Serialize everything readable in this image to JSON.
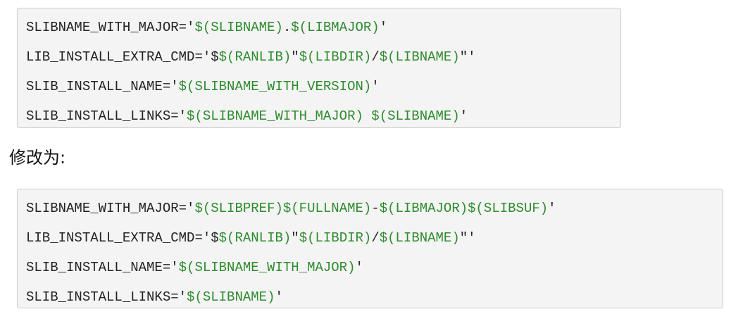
{
  "before_block": {
    "lines": [
      [
        {
          "t": "SLIBNAME_WITH_MAJOR='",
          "c": "plain"
        },
        {
          "t": "$(SLIBNAME)",
          "c": "str"
        },
        {
          "t": ".",
          "c": "plain"
        },
        {
          "t": "$(LIBMAJOR)",
          "c": "str"
        },
        {
          "t": "'",
          "c": "plain"
        }
      ],
      [
        {
          "t": "LIB_INSTALL_EXTRA_CMD='$",
          "c": "plain"
        },
        {
          "t": "$(RANLIB)",
          "c": "str"
        },
        {
          "t": "\"",
          "c": "plain"
        },
        {
          "t": "$(LIBDIR)",
          "c": "str"
        },
        {
          "t": "/",
          "c": "plain"
        },
        {
          "t": "$(LIBNAME)",
          "c": "str"
        },
        {
          "t": "\"'",
          "c": "plain"
        }
      ],
      [
        {
          "t": "SLIB_INSTALL_NAME='",
          "c": "plain"
        },
        {
          "t": "$(SLIBNAME_WITH_VERSION)",
          "c": "str"
        },
        {
          "t": "'",
          "c": "plain"
        }
      ],
      [
        {
          "t": "SLIB_INSTALL_LINKS='",
          "c": "plain"
        },
        {
          "t": "$(SLIBNAME_WITH_MAJOR)",
          "c": "str"
        },
        {
          "t": " ",
          "c": "plain"
        },
        {
          "t": "$(SLIBNAME)",
          "c": "str"
        },
        {
          "t": "'",
          "c": "plain"
        }
      ]
    ]
  },
  "heading": "修改为:",
  "after_block": {
    "lines": [
      [
        {
          "t": "SLIBNAME_WITH_MAJOR='",
          "c": "plain"
        },
        {
          "t": "$(SLIBPREF)",
          "c": "str"
        },
        {
          "t": "$(FULLNAME)",
          "c": "str"
        },
        {
          "t": "-",
          "c": "plain"
        },
        {
          "t": "$(LIBMAJOR)",
          "c": "str"
        },
        {
          "t": "$(SLIBSUF)",
          "c": "str"
        },
        {
          "t": "'",
          "c": "plain"
        }
      ],
      [
        {
          "t": "LIB_INSTALL_EXTRA_CMD='$",
          "c": "plain"
        },
        {
          "t": "$(RANLIB)",
          "c": "str"
        },
        {
          "t": "\"",
          "c": "plain"
        },
        {
          "t": "$(LIBDIR)",
          "c": "str"
        },
        {
          "t": "/",
          "c": "plain"
        },
        {
          "t": "$(LIBNAME)",
          "c": "str"
        },
        {
          "t": "\"'",
          "c": "plain"
        }
      ],
      [
        {
          "t": "SLIB_INSTALL_NAME='",
          "c": "plain"
        },
        {
          "t": "$(SLIBNAME_WITH_MAJOR)",
          "c": "str"
        },
        {
          "t": "'",
          "c": "plain"
        }
      ],
      [
        {
          "t": "SLIB_INSTALL_LINKS='",
          "c": "plain"
        },
        {
          "t": "$(SLIBNAME)",
          "c": "str"
        },
        {
          "t": "'",
          "c": "plain"
        }
      ]
    ]
  },
  "colors": {
    "code_background": "#f4f4f4",
    "code_border": "#cccccc",
    "string_token": "#2e8b2e",
    "plain_text": "#222222"
  }
}
